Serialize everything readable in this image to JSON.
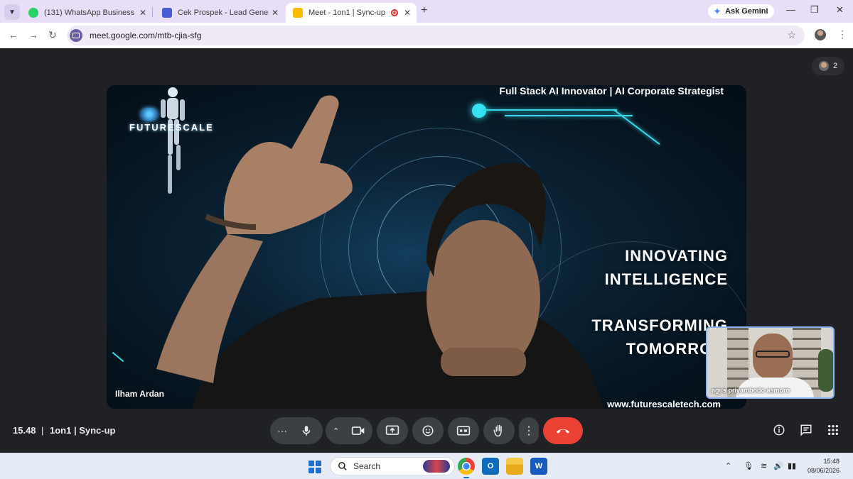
{
  "browser": {
    "tabs": [
      {
        "title": "(131) WhatsApp Business",
        "favicon": "whatsapp-icon"
      },
      {
        "title": "Cek Prospek - Lead Generation",
        "favicon": "page-icon"
      },
      {
        "title": "Meet - 1on1 | Sync-up",
        "favicon": "meet-icon",
        "active": true
      }
    ],
    "new_tab": "+",
    "ask_gemini": "Ask Gemini",
    "url": "meet.google.com/mtb-cjia-sfg"
  },
  "meet": {
    "participant_count": "2",
    "background": {
      "tagline": "Full Stack AI Innovator | AI Corporate Strategist",
      "brand": "FUTURESCALE",
      "slogan_lines": [
        "INNOVATING",
        "INTELLIGENCE",
        "TRANSFORMING",
        "TOMORROW"
      ],
      "website": "www.futurescaletech.com"
    },
    "main_participant_name": "Ilham Ardan",
    "self_participant_name": "agus priyambodo asmoro",
    "time": "15.48",
    "separator": "|",
    "meeting_title": "1on1 | Sync-up",
    "colors": {
      "accent": "#8ab4f8",
      "end_call": "#ea4335",
      "glow": "#37d6e6"
    }
  },
  "taskbar": {
    "search_label": "Search",
    "time": "15:48",
    "date": "08/06/2026"
  }
}
